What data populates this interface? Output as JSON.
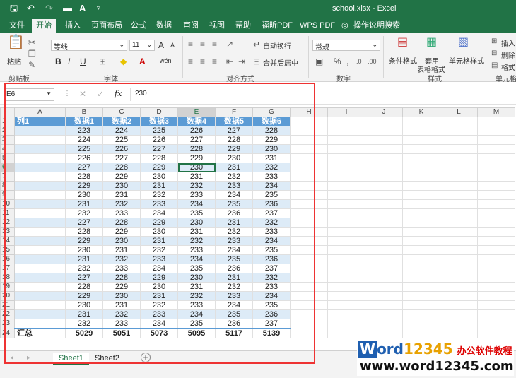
{
  "window": {
    "title": "school.xlsx  -  Excel"
  },
  "quick_access": {
    "save_icon": "save-icon",
    "undo_icon": "undo-icon",
    "redo_icon": "redo-icon",
    "open_icon": "folder-icon",
    "font_color_icon": "font-color-icon",
    "customize_icon": "customize-icon"
  },
  "menu": {
    "tabs": [
      "文件",
      "开始",
      "插入",
      "页面布局",
      "公式",
      "数据",
      "审阅",
      "视图",
      "帮助",
      "福昕PDF",
      "WPS PDF"
    ],
    "active": "开始",
    "search": "操作说明搜索"
  },
  "ribbon": {
    "clipboard": {
      "paste": "粘贴",
      "label": "剪贴板"
    },
    "font": {
      "name": "等线",
      "size": "11",
      "grow": "A",
      "shrink": "A",
      "bold": "B",
      "italic": "I",
      "underline": "U",
      "label": "字体",
      "wen": "wén"
    },
    "alignment": {
      "wrap": "自动换行",
      "merge": "合并后居中",
      "label": "对齐方式"
    },
    "number": {
      "format": "常规",
      "percent": "%",
      "comma": ",",
      "label": "数字"
    },
    "styles": {
      "cond": "条件格式",
      "table": "套用\n表格格式",
      "cell": "单元格样式",
      "label": "样式"
    },
    "cells": {
      "insert": "插入",
      "delete": "删除",
      "format": "格式",
      "label": "单元格"
    }
  },
  "formula_bar": {
    "name_box": "E6",
    "fx": "fx",
    "value": "230"
  },
  "sheet": {
    "columns": [
      "A",
      "B",
      "C",
      "D",
      "E",
      "F",
      "G",
      "H",
      "I",
      "J",
      "K",
      "L",
      "M"
    ],
    "header": [
      "列1",
      "数据1",
      "数据2",
      "数据3",
      "数据4",
      "数据5",
      "数据6"
    ],
    "rows": [
      [
        223,
        224,
        225,
        226,
        227,
        228
      ],
      [
        224,
        225,
        226,
        227,
        228,
        229
      ],
      [
        225,
        226,
        227,
        228,
        229,
        230
      ],
      [
        226,
        227,
        228,
        229,
        230,
        231
      ],
      [
        227,
        228,
        229,
        230,
        231,
        232
      ],
      [
        228,
        229,
        230,
        231,
        232,
        233
      ],
      [
        229,
        230,
        231,
        232,
        233,
        234
      ],
      [
        230,
        231,
        232,
        233,
        234,
        235
      ],
      [
        231,
        232,
        233,
        234,
        235,
        236
      ],
      [
        232,
        233,
        234,
        235,
        236,
        237
      ],
      [
        227,
        228,
        229,
        230,
        231,
        232
      ],
      [
        228,
        229,
        230,
        231,
        232,
        233
      ],
      [
        229,
        230,
        231,
        232,
        233,
        234
      ],
      [
        230,
        231,
        232,
        233,
        234,
        235
      ],
      [
        231,
        232,
        233,
        234,
        235,
        236
      ],
      [
        232,
        233,
        234,
        235,
        236,
        237
      ],
      [
        227,
        228,
        229,
        230,
        231,
        232
      ],
      [
        228,
        229,
        230,
        231,
        232,
        233
      ],
      [
        229,
        230,
        231,
        232,
        233,
        234
      ],
      [
        230,
        231,
        232,
        233,
        234,
        235
      ],
      [
        231,
        232,
        233,
        234,
        235,
        236
      ],
      [
        232,
        233,
        234,
        235,
        236,
        237
      ]
    ],
    "total_label": "汇总",
    "totals": [
      5029,
      5051,
      5073,
      5095,
      5117,
      5139
    ],
    "selected": "E6"
  },
  "sheet_tabs": [
    "Sheet1",
    "Sheet2"
  ],
  "add_sheet": "+",
  "watermark": {
    "brand_a": "W",
    "brand_b": "ord",
    "brand_c": "12345",
    "brand_d": "办公软件教程",
    "url": "www.word12345.com"
  },
  "colors": {
    "excel_green": "#217346",
    "table_header": "#5b9bd5",
    "band": "#ddebf7",
    "highlight_box": "#e33333"
  }
}
